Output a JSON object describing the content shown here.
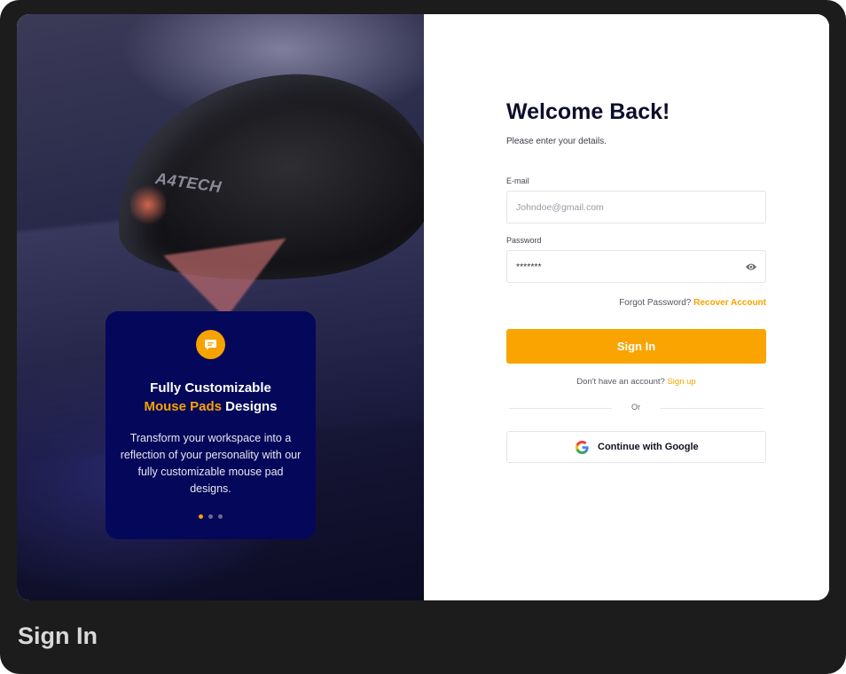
{
  "hero": {
    "brand_text": "A4TECH",
    "promo": {
      "icon": "chat-bubble-icon",
      "title_line1": "Fully Customizable",
      "title_accent": "Mouse Pads",
      "title_rest": "Designs",
      "description": "Transform your workspace into a reflection of your personality with our fully customizable mouse pad designs.",
      "slides_total": 3,
      "active_slide": 1
    }
  },
  "form": {
    "heading": "Welcome Back!",
    "subheading": "Please enter your details.",
    "email": {
      "label": "E-mail",
      "value": "",
      "placeholder": "Johndoe@gmail.com"
    },
    "password": {
      "label": "Password",
      "value": "*******",
      "toggle_icon": "eye-icon"
    },
    "forgot_text": "Forgot Password?",
    "recover_link": "Recover Account",
    "signin_button": "Sign In",
    "no_account_text": "Don't have an account?",
    "signup_link": "Sign up",
    "or_text": "Or",
    "google_button": "Continue with Google",
    "google_icon": "google-icon"
  },
  "colors": {
    "accent": "#f9a400",
    "promo_bg": "#05075a",
    "heading": "#0d0d2b",
    "frame_bg": "#1c1c1c"
  },
  "caption": "Sign In"
}
